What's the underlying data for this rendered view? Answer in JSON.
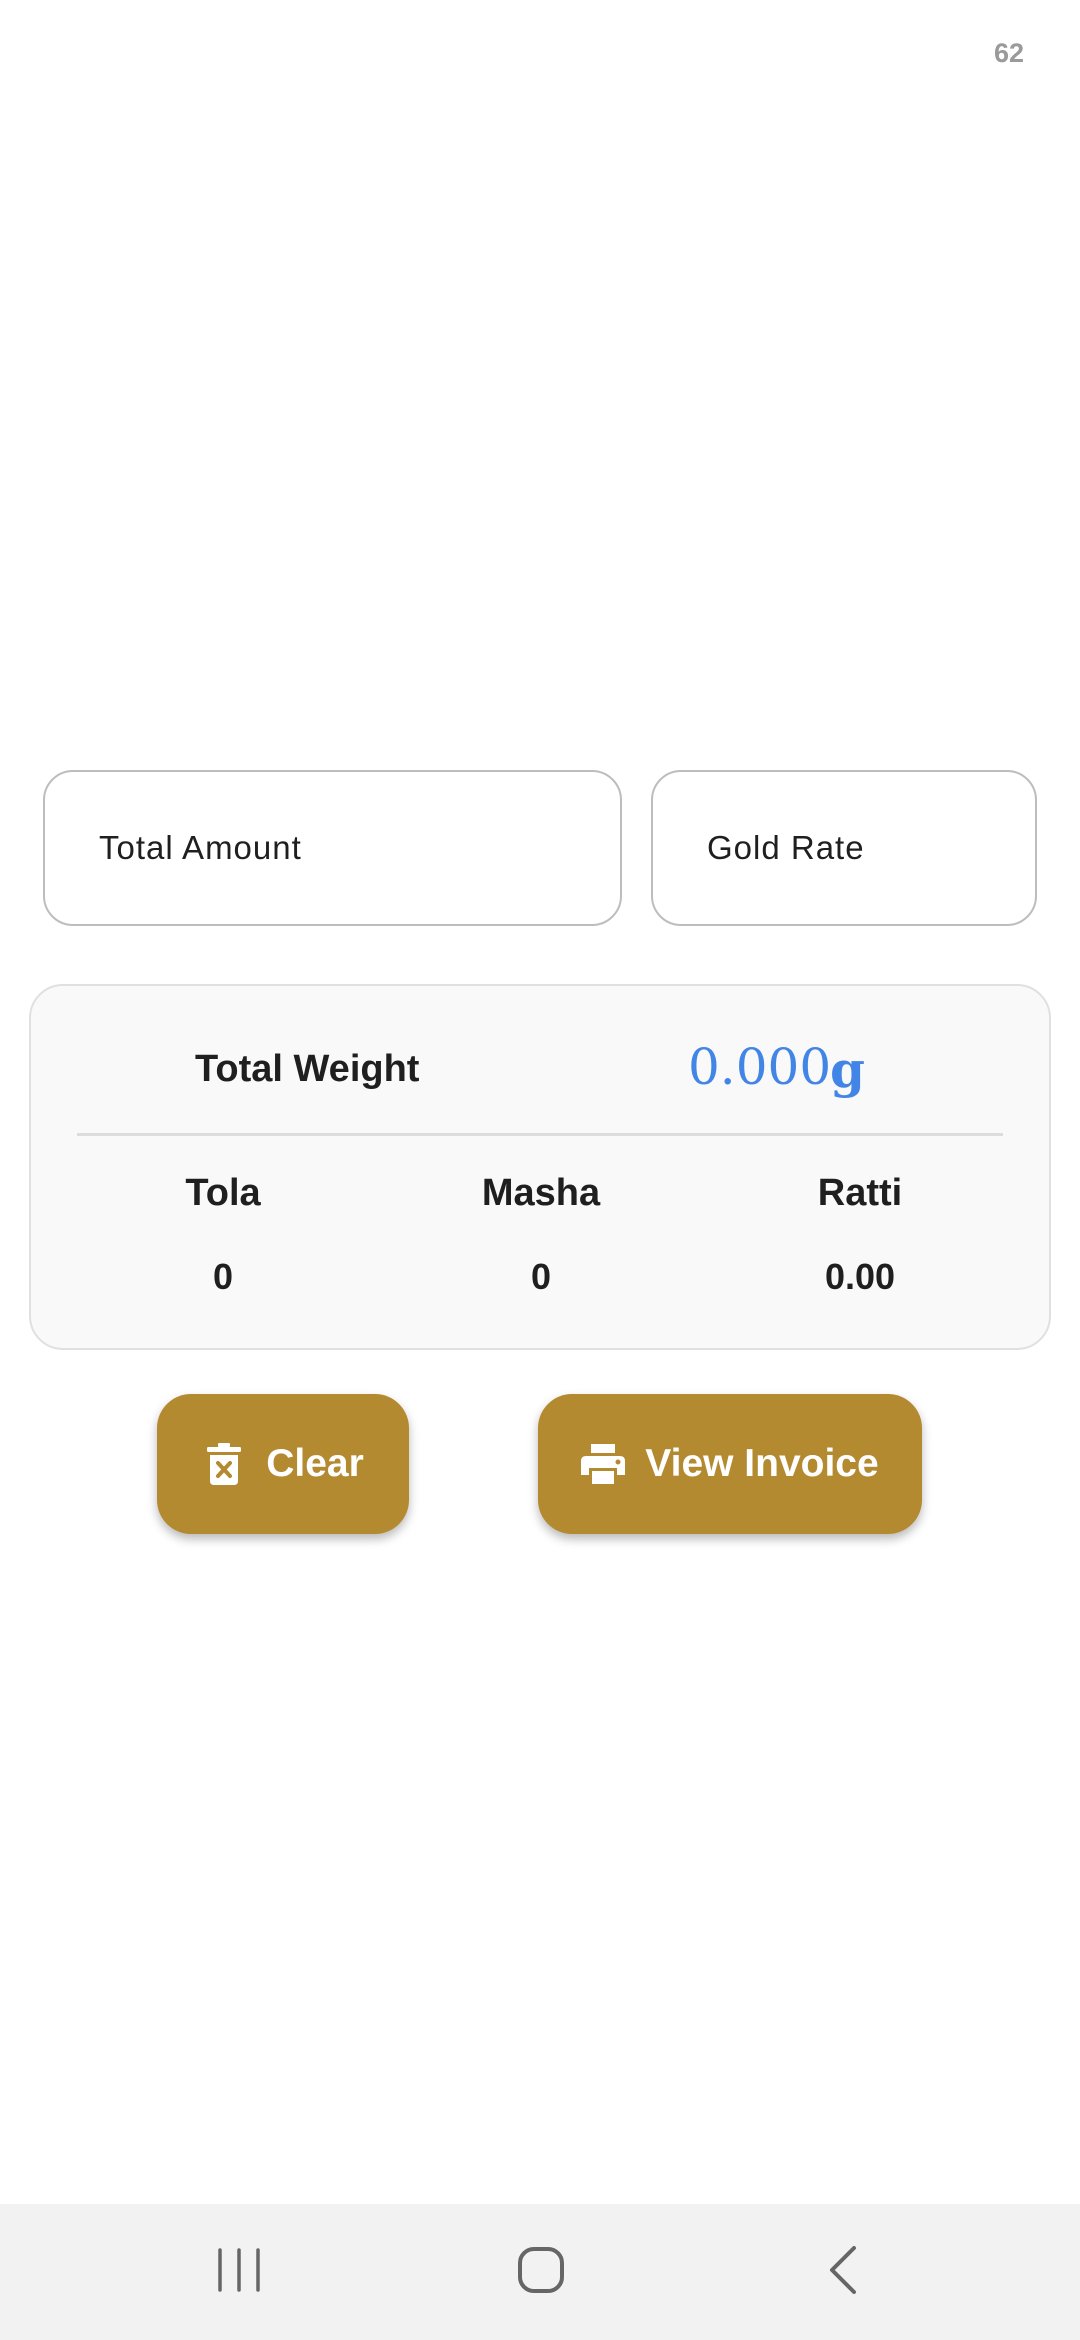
{
  "status_bar": {
    "number": "62"
  },
  "fields": {
    "total_amount": {
      "placeholder": "Total Amount",
      "value": ""
    },
    "gold_rate": {
      "placeholder": "Gold Rate",
      "value": ""
    }
  },
  "weight_card": {
    "label": "Total Weight",
    "value": "0.000",
    "unit": "g",
    "columns": [
      {
        "name": "Tola",
        "value": "0"
      },
      {
        "name": "Masha",
        "value": "0"
      },
      {
        "name": "Ratti",
        "value": "0.00"
      }
    ]
  },
  "buttons": {
    "clear": {
      "label": "Clear",
      "icon": "trash-icon"
    },
    "view_invoice": {
      "label": "View Invoice",
      "icon": "printer-icon"
    }
  },
  "nav_bar": {
    "items": [
      {
        "icon": "recents-icon"
      },
      {
        "icon": "home-icon"
      },
      {
        "icon": "back-icon"
      }
    ]
  },
  "colors": {
    "accent": "#b38a30",
    "weight_value": "#4285e6",
    "card_background": "#f9f9f9"
  }
}
